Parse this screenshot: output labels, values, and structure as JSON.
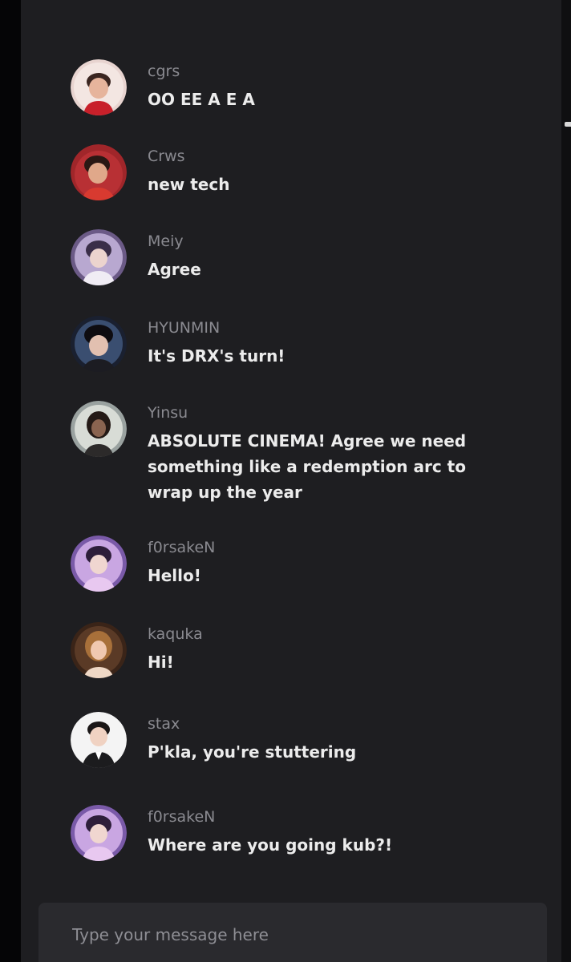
{
  "chat": {
    "messages": [
      {
        "username": "cgrs",
        "text": "OO EE A E A",
        "avatar": "avatar-cgrs"
      },
      {
        "username": "Crws",
        "text": "new tech",
        "avatar": "avatar-crws"
      },
      {
        "username": "Meiy",
        "text": "Agree",
        "avatar": "avatar-meiy"
      },
      {
        "username": "HYUNMIN",
        "text": "It's DRX's turn!",
        "avatar": "avatar-hyunmin"
      },
      {
        "username": "Yinsu",
        "text": "ABSOLUTE CINEMA! Agree we need something like a redemption arc to wrap up the year",
        "avatar": "avatar-yinsu"
      },
      {
        "username": "f0rsakeN",
        "text": "Hello!",
        "avatar": "avatar-forsaken"
      },
      {
        "username": "kaquka",
        "text": "Hi!",
        "avatar": "avatar-kaquka"
      },
      {
        "username": "stax",
        "text": "P'kla, you're stuttering",
        "avatar": "avatar-stax"
      },
      {
        "username": "f0rsakeN",
        "text": "Where are you going kub?!",
        "avatar": "avatar-forsaken"
      }
    ]
  },
  "composer": {
    "placeholder": "Type your message here",
    "value": ""
  },
  "colors": {
    "panel_background": "#1e1e21",
    "username": "#8a8a90",
    "message_text": "#ececec",
    "composer_background": "#2a2a2e"
  }
}
